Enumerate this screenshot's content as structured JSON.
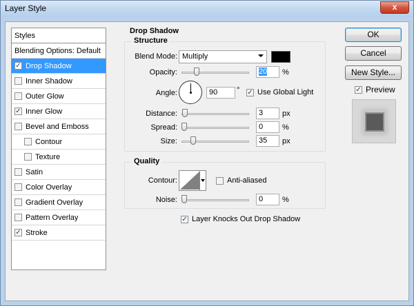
{
  "window": {
    "title": "Layer Style",
    "close_label": "x"
  },
  "styles": {
    "header": "Styles",
    "items": [
      {
        "label": "Blending Options: Default",
        "checkbox": false,
        "checked": false,
        "selected": false,
        "indent": false
      },
      {
        "label": "Drop Shadow",
        "checkbox": true,
        "checked": true,
        "selected": true,
        "indent": false
      },
      {
        "label": "Inner Shadow",
        "checkbox": true,
        "checked": false,
        "selected": false,
        "indent": false
      },
      {
        "label": "Outer Glow",
        "checkbox": true,
        "checked": false,
        "selected": false,
        "indent": false
      },
      {
        "label": "Inner Glow",
        "checkbox": true,
        "checked": true,
        "selected": false,
        "indent": false
      },
      {
        "label": "Bevel and Emboss",
        "checkbox": true,
        "checked": false,
        "selected": false,
        "indent": false
      },
      {
        "label": "Contour",
        "checkbox": true,
        "checked": false,
        "selected": false,
        "indent": true
      },
      {
        "label": "Texture",
        "checkbox": true,
        "checked": false,
        "selected": false,
        "indent": true
      },
      {
        "label": "Satin",
        "checkbox": true,
        "checked": false,
        "selected": false,
        "indent": false
      },
      {
        "label": "Color Overlay",
        "checkbox": true,
        "checked": false,
        "selected": false,
        "indent": false
      },
      {
        "label": "Gradient Overlay",
        "checkbox": true,
        "checked": false,
        "selected": false,
        "indent": false
      },
      {
        "label": "Pattern Overlay",
        "checkbox": true,
        "checked": false,
        "selected": false,
        "indent": false
      },
      {
        "label": "Stroke",
        "checkbox": true,
        "checked": true,
        "selected": false,
        "indent": false
      }
    ]
  },
  "drop_shadow": {
    "section_title": "Drop Shadow",
    "structure": {
      "title": "Structure",
      "blend_mode_label": "Blend Mode:",
      "blend_mode_value": "Multiply",
      "shadow_color": "#000000",
      "opacity_label": "Opacity:",
      "opacity_value": "20",
      "opacity_unit": "%",
      "opacity_fraction": 0.2,
      "angle_label": "Angle:",
      "angle_value": "90",
      "angle_unit": "°",
      "use_global_light_label": "Use Global Light",
      "use_global_light_checked": true,
      "distance_label": "Distance:",
      "distance_value": "3",
      "distance_unit": "px",
      "distance_fraction": 0.01,
      "spread_label": "Spread:",
      "spread_value": "0",
      "spread_unit": "%",
      "spread_fraction": 0.0,
      "size_label": "Size:",
      "size_value": "35",
      "size_unit": "px",
      "size_fraction": 0.14
    },
    "quality": {
      "title": "Quality",
      "contour_label": "Contour:",
      "anti_aliased_label": "Anti-aliased",
      "anti_aliased_checked": false,
      "noise_label": "Noise:",
      "noise_value": "0",
      "noise_unit": "%",
      "noise_fraction": 0.0
    },
    "knockout_label": "Layer Knocks Out Drop Shadow",
    "knockout_checked": true
  },
  "buttons": {
    "ok": "OK",
    "cancel": "Cancel",
    "new_style": "New Style...",
    "preview_label": "Preview",
    "preview_checked": true
  },
  "colors": {
    "selection": "#3399ff",
    "preview_fill": "#5a5a5a"
  }
}
